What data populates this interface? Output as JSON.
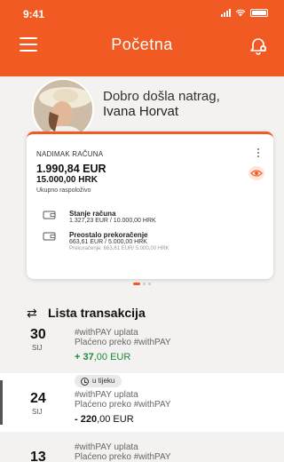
{
  "status_bar": {
    "time": "9:41"
  },
  "header": {
    "title": "Početna",
    "menu_icon": "hamburger-menu-icon",
    "bell_icon": "notification-bell-icon"
  },
  "welcome": {
    "greeting": "Dobro došla natrag,",
    "name": "Ivana Horvat"
  },
  "account_card": {
    "label": "NADIMAK RAČUNA",
    "balance_eur": "1.990,84 EUR",
    "balance_hrk": "15.000,00 HRK",
    "balance_caption": "Ukupno raspoloživo",
    "rows": [
      {
        "title": "Stanje računa",
        "value": "1.327,23 EUR / 10.000,00 HRK"
      },
      {
        "title": "Preostalo prekoračenje",
        "value": "663,61 EUR / 5.000,00 HRK",
        "sub": "Prekoračenje: 663,61 EUR/ 5.000,00 HRK"
      }
    ],
    "pager": {
      "pages": 3,
      "active": 0
    }
  },
  "transactions": {
    "title": "Lista transakcija",
    "items": [
      {
        "day": "30",
        "month": "SIJ",
        "name": "#withPAY uplata",
        "desc": "Plaćeno preko #withPAY",
        "amount_int": "+ 37",
        "amount_dec": ",00 EUR",
        "color": "#1b8a3a"
      },
      {
        "day": "24",
        "month": "SIJ",
        "status": "u tijeku",
        "name": "#withPAY uplata",
        "desc": "Plaćeno preko #withPAY",
        "amount_int": "- 220",
        "amount_dec": ",00 EUR",
        "color": "#111111"
      },
      {
        "day": "13",
        "month": "",
        "name": "#withPAY uplata",
        "desc": "Plaćeno preko #withPAY"
      }
    ]
  },
  "colors": {
    "brand": "#f15a22",
    "positive": "#1b8a3a"
  }
}
